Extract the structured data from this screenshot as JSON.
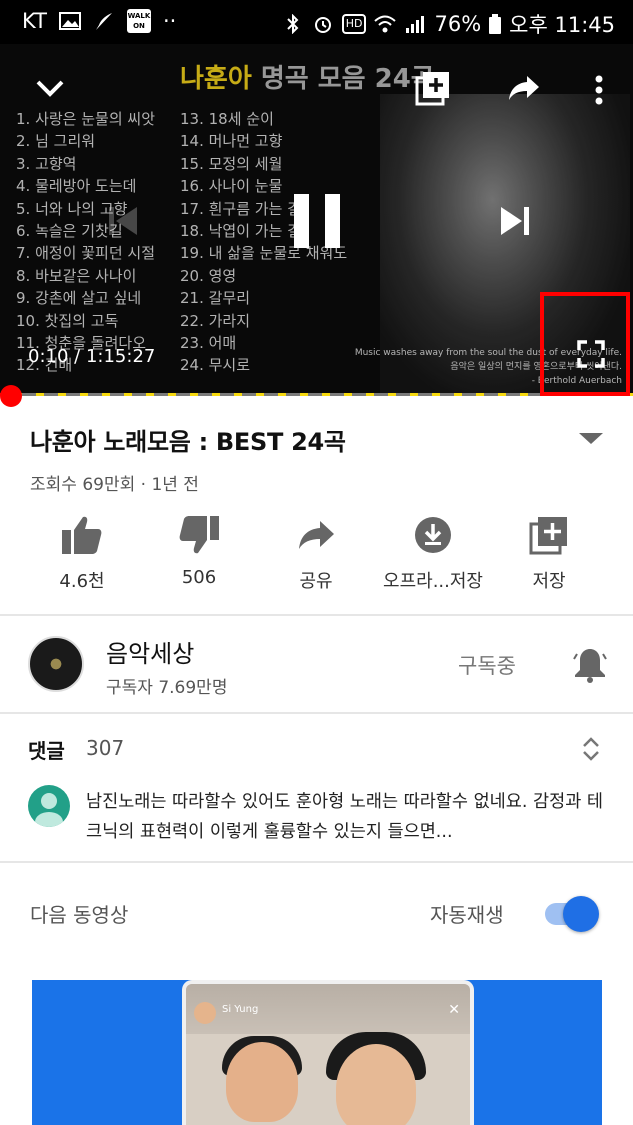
{
  "status_bar": {
    "carrier": "KT",
    "walk_badge": "WALK ON",
    "more": "··",
    "hd_badge": "HD",
    "battery": "76%",
    "time": "오후 11:45"
  },
  "player": {
    "art": {
      "title_highlight": "나훈아",
      "title_rest": "명곡 모음 24곡",
      "songs_col1": [
        "1. 사랑은 눈물의 씨앗",
        "2. 님 그리워",
        "3. 고향역",
        "4. 물레방아 도는데",
        "5. 너와 나의 고향",
        "6. 녹슬은 기찻길",
        "7. 애정이 꽃피던 시절",
        "8. 바보같은 사나이",
        "9. 강촌에 살고 싶네",
        "10. 찻집의 고독",
        "11. 청춘을 돌려다오",
        "12. 건배"
      ],
      "songs_col2": [
        "13. 18세 순이",
        "14. 머나먼 고향",
        "15. 모정의 세월",
        "16. 사나이 눈물",
        "17. 흰구름 가는 길",
        "18. 낙엽이 가는 길",
        "19. 내 삶을 눈물로 채워도",
        "20. 영영",
        "21. 갈무리",
        "22. 가라지",
        "23. 어매",
        "24. 무시로"
      ],
      "quote_en": "Music washes away from the soul the dust of everyday life.",
      "quote_kr": "음악은 일상의 먼지를 영혼으로부터 씻어낸다.",
      "quote_author": "- Berthold Auerbach"
    },
    "current_time": "0:10",
    "duration": "1:15:27",
    "progress_fraction": 0.0022
  },
  "video": {
    "title": "나훈아 노래모음 : BEST 24곡",
    "meta": "조회수 69만회 · 1년 전"
  },
  "actions": [
    {
      "label": "4.6천",
      "icon": "thumbs-up-icon"
    },
    {
      "label": "506",
      "icon": "thumbs-down-icon"
    },
    {
      "label": "공유",
      "icon": "share-icon"
    },
    {
      "label": "오프라...저장",
      "icon": "download-icon"
    },
    {
      "label": "저장",
      "icon": "add-to-playlist-icon"
    }
  ],
  "channel": {
    "name": "음악세상",
    "subscribers": "구독자 7.69만명",
    "subscribed_label": "구독중",
    "avatar_text": "MUSICBOX"
  },
  "comments": {
    "heading": "댓글",
    "count": "307",
    "top_comment": "남진노래는 따라할수 있어도 훈아형  노래는 따라할수 없네요. 감정과 테크닉의  표현력이  이렇게 훌륭할수 있는지 들으면..."
  },
  "up_next": {
    "label": "다음 동영상",
    "autoplay_label": "자동재생",
    "autoplay_on": true,
    "thumb_name": "Si Yung"
  },
  "colors": {
    "accent_red": "#ff0000",
    "toggle_blue": "#1f6fe5",
    "thumb_blue": "#1a73e8",
    "title_yellow": "#f3d21c"
  }
}
